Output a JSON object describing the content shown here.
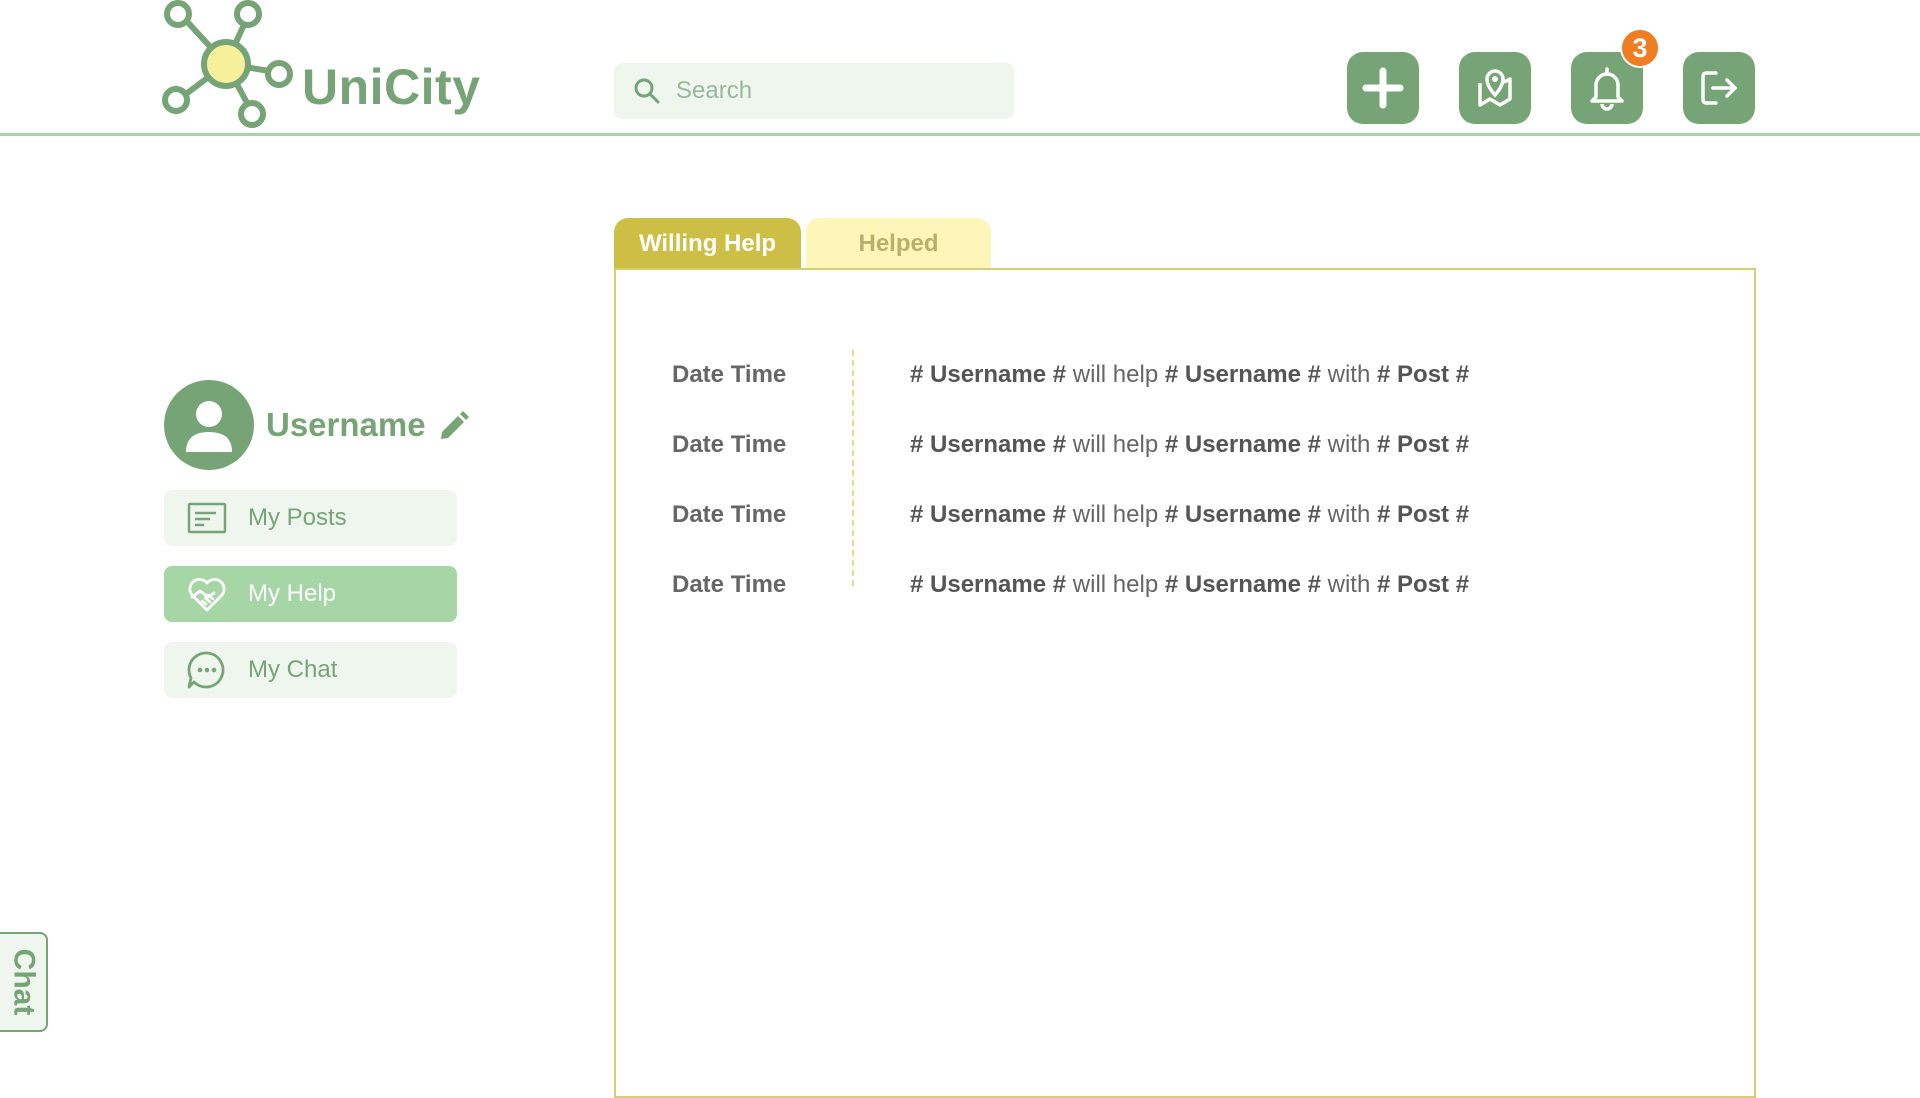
{
  "app": {
    "name": "UniCity"
  },
  "search": {
    "placeholder": "Search"
  },
  "toolbar": {
    "notification_count": "3"
  },
  "profile": {
    "username": "Username"
  },
  "sidebar": {
    "items": [
      {
        "label": "My Posts",
        "icon": "posts-icon"
      },
      {
        "label": "My Help",
        "icon": "heart-hand-icon",
        "active": true
      },
      {
        "label": "My Chat",
        "icon": "chat-bubble-icon"
      }
    ]
  },
  "tabs": [
    {
      "label": "Willing Help",
      "active": true
    },
    {
      "label": "Helped",
      "active": false
    }
  ],
  "feed": [
    {
      "datetime": "Date Time",
      "hash": "#",
      "user1": "Username",
      "verb": "will help",
      "user2": "Username",
      "with": "with",
      "post": "Post"
    },
    {
      "datetime": "Date Time",
      "hash": "#",
      "user1": "Username",
      "verb": "will help",
      "user2": "Username",
      "with": "with",
      "post": "Post"
    },
    {
      "datetime": "Date Time",
      "hash": "#",
      "user1": "Username",
      "verb": "will help",
      "user2": "Username",
      "with": "with",
      "post": "Post"
    },
    {
      "datetime": "Date Time",
      "hash": "#",
      "user1": "Username",
      "verb": "will help",
      "user2": "Username",
      "with": "with",
      "post": "Post"
    }
  ],
  "chat_tab": {
    "label": "Chat"
  },
  "colors": {
    "primary": "#76a476",
    "light": "#a6d5a6",
    "accent": "#cdbf45",
    "badge": "#ee7d24"
  }
}
